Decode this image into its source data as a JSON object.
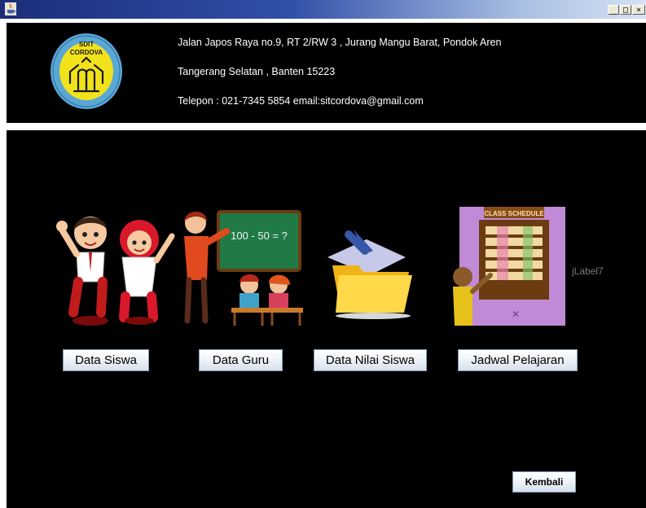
{
  "window": {
    "title": "",
    "controls": {
      "minimize": "_",
      "maximize": "□",
      "close": "×"
    }
  },
  "header": {
    "logo": {
      "text_top": "SDIT",
      "text_mid": "CORDOVA"
    },
    "address_line1": "Jalan Japos Raya no.9, RT 2/RW 3 , Jurang Mangu Barat, Pondok Aren",
    "address_line2": "Tangerang Selatan , Banten 15223",
    "contact_line": "Telepon : 021-7345 5854  email:sitcordova@gmail.com"
  },
  "menu": {
    "data_siswa": "Data Siswa",
    "data_guru": "Data Guru",
    "data_nilai": "Data Nilai Siswa",
    "jadwal": "Jadwal Pelajaran"
  },
  "illustrations": {
    "chalkboard_text": "100 - 50 = ?",
    "schedule_title": "CLASS SCHEDULE"
  },
  "placeholder_label": "jLabel7",
  "kembali_label": "Kembali",
  "colors": {
    "background": "#000000",
    "logo_yellow": "#f2e21c",
    "logo_blue": "#5aa7d6",
    "button_border": "#7f9db9"
  }
}
